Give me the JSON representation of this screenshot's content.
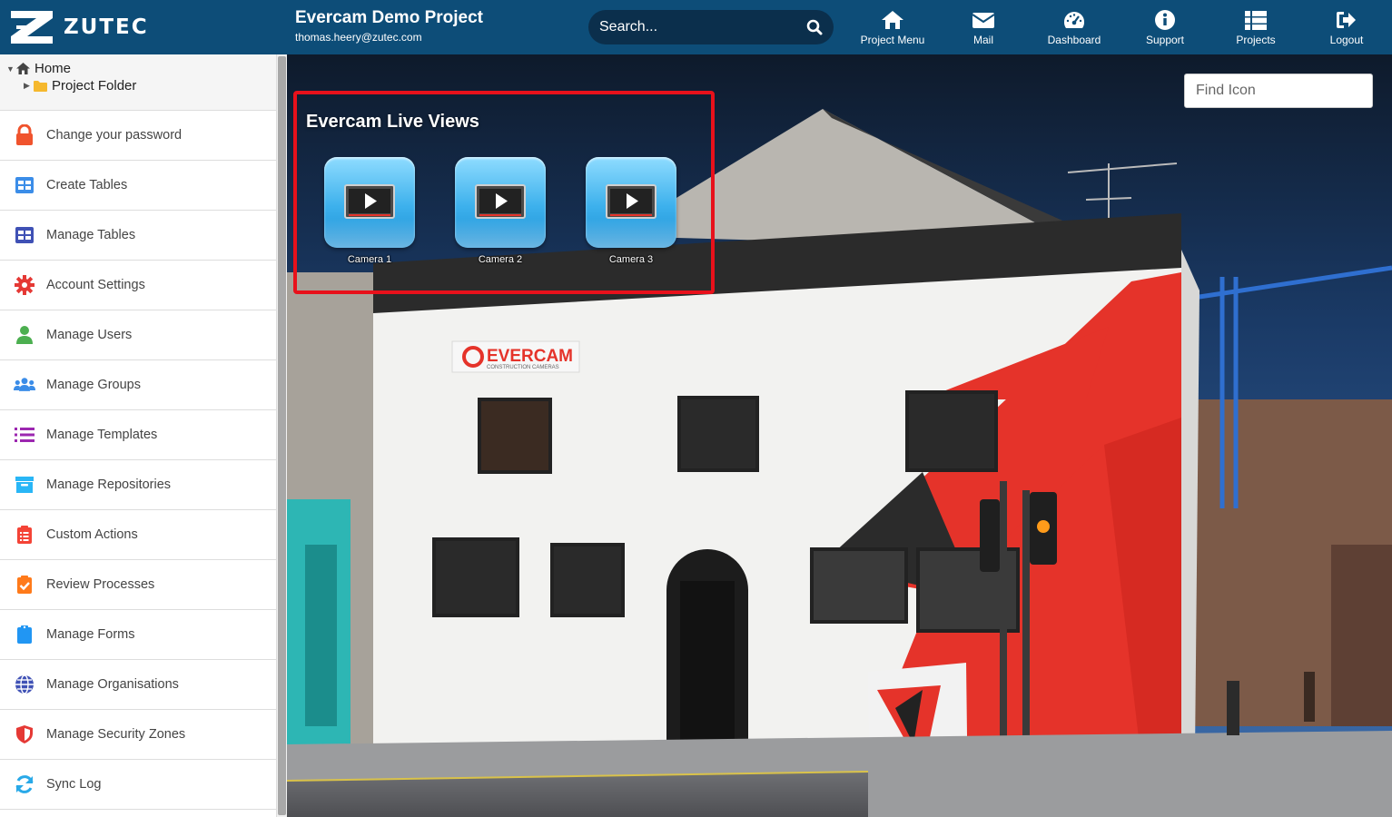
{
  "header": {
    "logo_text": "ZUTEC",
    "project_title": "Evercam Demo Project",
    "user_email": "thomas.heery@zutec.com",
    "search_placeholder": "Search...",
    "nav": [
      {
        "label": "Project Menu",
        "icon": "home-icon"
      },
      {
        "label": "Mail",
        "icon": "mail-icon"
      },
      {
        "label": "Dashboard",
        "icon": "dashboard-icon"
      },
      {
        "label": "Support",
        "icon": "info-icon"
      },
      {
        "label": "Projects",
        "icon": "projects-icon"
      },
      {
        "label": "Logout",
        "icon": "logout-icon"
      }
    ]
  },
  "sidebar": {
    "tree": {
      "home": "Home",
      "folder": "Project Folder"
    },
    "items": [
      {
        "label": "Change your password",
        "icon": "lock-icon",
        "color": "#f0532d"
      },
      {
        "label": "Create Tables",
        "icon": "table-icon",
        "color": "#3b8de8"
      },
      {
        "label": "Manage Tables",
        "icon": "table-icon",
        "color": "#3f51b5"
      },
      {
        "label": "Account Settings",
        "icon": "gear-icon",
        "color": "#e53935"
      },
      {
        "label": "Manage Users",
        "icon": "user-icon",
        "color": "#4caf50"
      },
      {
        "label": "Manage Groups",
        "icon": "users-icon",
        "color": "#3b8de8"
      },
      {
        "label": "Manage Templates",
        "icon": "list-icon",
        "color": "#9c27b0"
      },
      {
        "label": "Manage Repositories",
        "icon": "archive-icon",
        "color": "#29b6f6"
      },
      {
        "label": "Custom Actions",
        "icon": "clipboard-list-icon",
        "color": "#f44336"
      },
      {
        "label": "Review Processes",
        "icon": "clipboard-check-icon",
        "color": "#ff7a1a"
      },
      {
        "label": "Manage Forms",
        "icon": "clipboard-icon",
        "color": "#2196f3"
      },
      {
        "label": "Manage Organisations",
        "icon": "globe-icon",
        "color": "#3f51b5"
      },
      {
        "label": "Manage Security Zones",
        "icon": "shield-icon",
        "color": "#e53935"
      },
      {
        "label": "Sync Log",
        "icon": "sync-icon",
        "color": "#29a9e8"
      }
    ]
  },
  "main": {
    "find_icon_placeholder": "Find Icon",
    "live_views_title": "Evercam Live Views",
    "cameras": [
      {
        "label": "Camera 1"
      },
      {
        "label": "Camera 2"
      },
      {
        "label": "Camera 3"
      }
    ],
    "building_sign": {
      "brand": "EVERCAM",
      "tagline": "CONSTRUCTION CAMERAS"
    }
  }
}
